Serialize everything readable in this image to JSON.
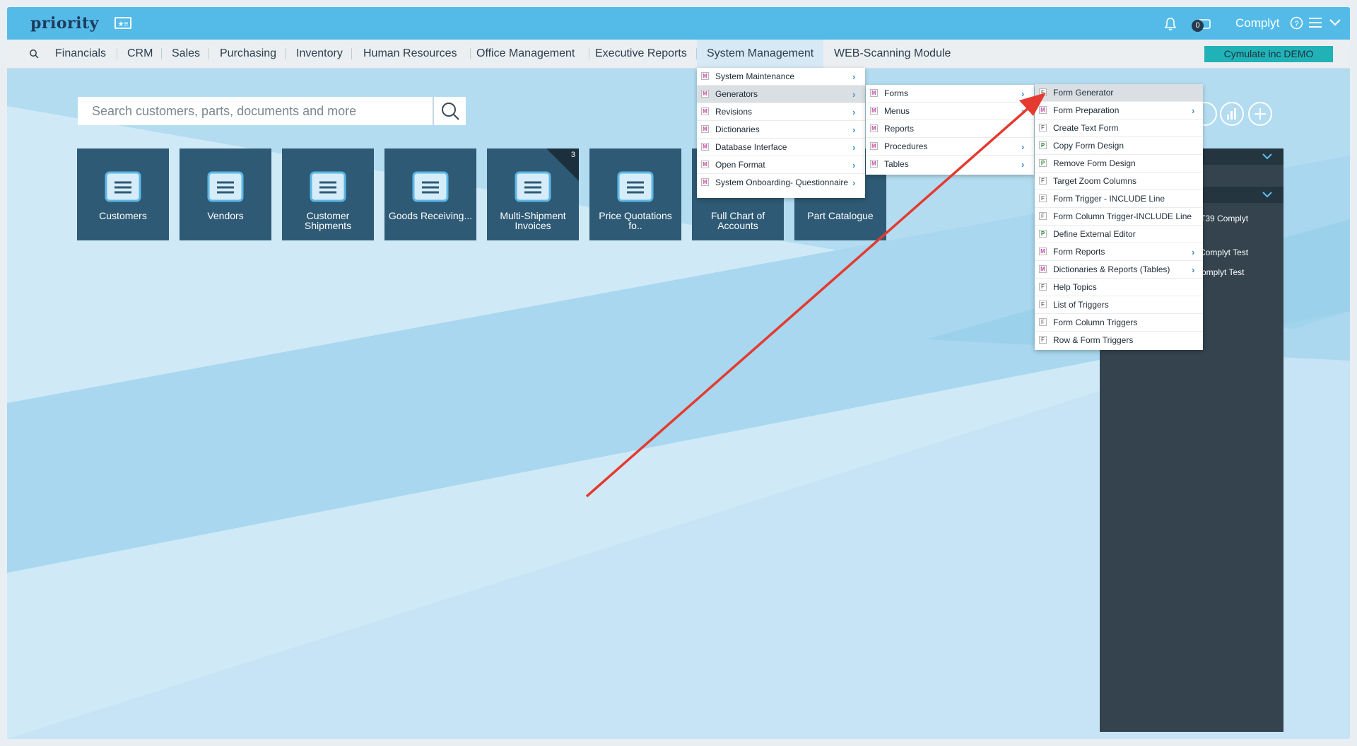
{
  "app": {
    "logo": "priority",
    "user": "Complyt",
    "notification_count": "0"
  },
  "menubar": {
    "items": [
      "Financials",
      "CRM",
      "Sales",
      "Purchasing",
      "Inventory",
      "Human Resources",
      "Office Management",
      "Executive Reports",
      "System Management",
      "WEB-Scanning Module"
    ],
    "company_button": "Cymulate inc DEMO"
  },
  "search": {
    "placeholder": "Search customers, parts, documents and more"
  },
  "tiles": [
    {
      "label": "Customers"
    },
    {
      "label": "Vendors"
    },
    {
      "label": "Customer Shipments"
    },
    {
      "label": "Goods Receiving..."
    },
    {
      "label": "Multi-Shipment Invoices",
      "badge": "3"
    },
    {
      "label": "Price Quotations fo.."
    },
    {
      "label": "Full Chart of Accounts"
    },
    {
      "label": "Part Catalogue"
    }
  ],
  "right_panel": {
    "lines": [
      "T39 Complyt",
      "Complyt Test",
      "omplyt Test"
    ]
  },
  "menu_level1": [
    {
      "type": "M",
      "label": "System Maintenance"
    },
    {
      "type": "M",
      "label": "Generators"
    },
    {
      "type": "M",
      "label": "Revisions"
    },
    {
      "type": "M",
      "label": "Dictionaries"
    },
    {
      "type": "M",
      "label": "Database Interface"
    },
    {
      "type": "M",
      "label": "Open Format"
    },
    {
      "type": "M",
      "label": "System Onboarding- Questionnaire"
    }
  ],
  "menu_level2": [
    {
      "type": "M",
      "label": "Forms"
    },
    {
      "type": "M",
      "label": "Menus"
    },
    {
      "type": "M",
      "label": "Reports"
    },
    {
      "type": "M",
      "label": "Procedures"
    },
    {
      "type": "M",
      "label": "Tables"
    }
  ],
  "menu_level3": [
    {
      "type": "F",
      "label": "Form Generator"
    },
    {
      "type": "M",
      "label": "Form Preparation"
    },
    {
      "type": "F",
      "label": "Create Text Form"
    },
    {
      "type": "P",
      "label": "Copy Form Design"
    },
    {
      "type": "P",
      "label": "Remove Form Design"
    },
    {
      "type": "F",
      "label": "Target Zoom Columns"
    },
    {
      "type": "F",
      "label": "Form Trigger - INCLUDE Line"
    },
    {
      "type": "F",
      "label": "Form Column Trigger-INCLUDE Line"
    },
    {
      "type": "P",
      "label": "Define External Editor"
    },
    {
      "type": "M",
      "label": "Form Reports"
    },
    {
      "type": "M",
      "label": "Dictionaries & Reports (Tables)"
    },
    {
      "type": "F",
      "label": "Help Topics"
    },
    {
      "type": "F",
      "label": "List of Triggers"
    },
    {
      "type": "F",
      "label": "Form Column Triggers"
    },
    {
      "type": "F",
      "label": "Row & Form Triggers"
    }
  ],
  "colors": {
    "topbar": "#54bbe9",
    "tile": "#2e5a75",
    "accent": "#21b2b8",
    "annotation_arrow": "#e53a2f"
  }
}
